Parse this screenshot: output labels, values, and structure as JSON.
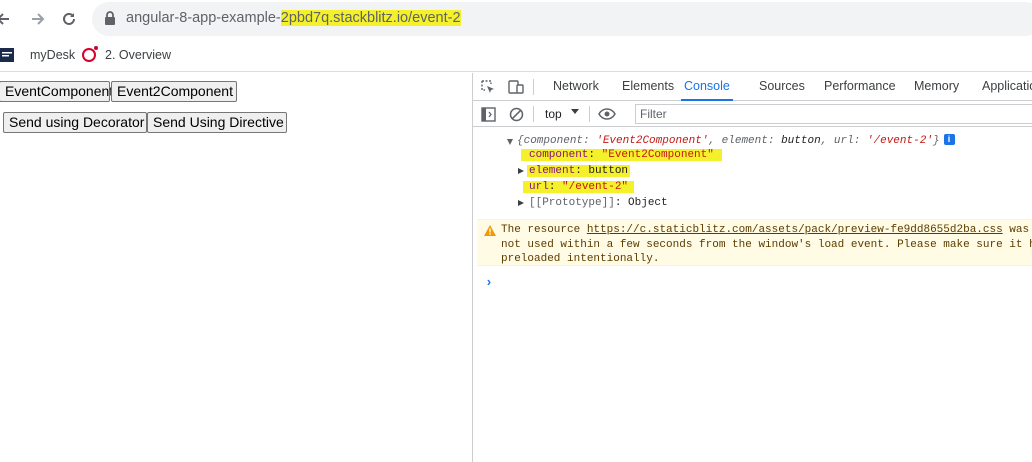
{
  "browser": {
    "url_host": "angular-8-app-example-2pbd7q.stackblitz.io",
    "url_host_plain": "angular-8-app-example-",
    "url_host_highlight": "2pbd7q.stackblitz.io",
    "url_path": "/event-2",
    "bookmarks": [
      {
        "label": "myDesk"
      },
      {
        "label": "2. Overview"
      }
    ]
  },
  "page": {
    "buttons_row1": [
      "EventComponent",
      "Event2Component"
    ],
    "buttons_row2": [
      "Send using Decorator",
      "Send Using Directive"
    ]
  },
  "devtools": {
    "tabs": [
      "Network",
      "Elements",
      "Console",
      "Sources",
      "Performance",
      "Memory",
      "Applicatio"
    ],
    "active_tab": "Console",
    "context": "top",
    "filter_placeholder": "Filter",
    "log": {
      "summary_open": "{",
      "summary_k1": "component",
      "summary_v1": "'Event2Component'",
      "summary_k2": "element",
      "summary_v2": "button",
      "summary_k3": "url",
      "summary_v3": "'/event-2'",
      "summary_close": "}",
      "info_badge": "i",
      "prop1_key": "component",
      "prop1_value": "\"Event2Component\"",
      "prop2_key": "element",
      "prop2_value": "button",
      "prop3_key": "url",
      "prop3_value": "\"/event-2\"",
      "proto_key": "[[Prototype]]",
      "proto_value": "Object"
    },
    "warning": {
      "line1_pre": "The resource ",
      "link": "https://c.staticblitz.com/assets/pack/preview-fe9dd8655d2ba.css",
      "line1_post": " was",
      "line2": "not used within a few seconds from the window's load event. Please make sure it h",
      "line3": "preloaded intentionally."
    },
    "prompt": "›"
  },
  "colors": {
    "highlight": "#f4f02a",
    "devtools_accent": "#1a73e8",
    "warning_bg": "#fffbe5"
  }
}
